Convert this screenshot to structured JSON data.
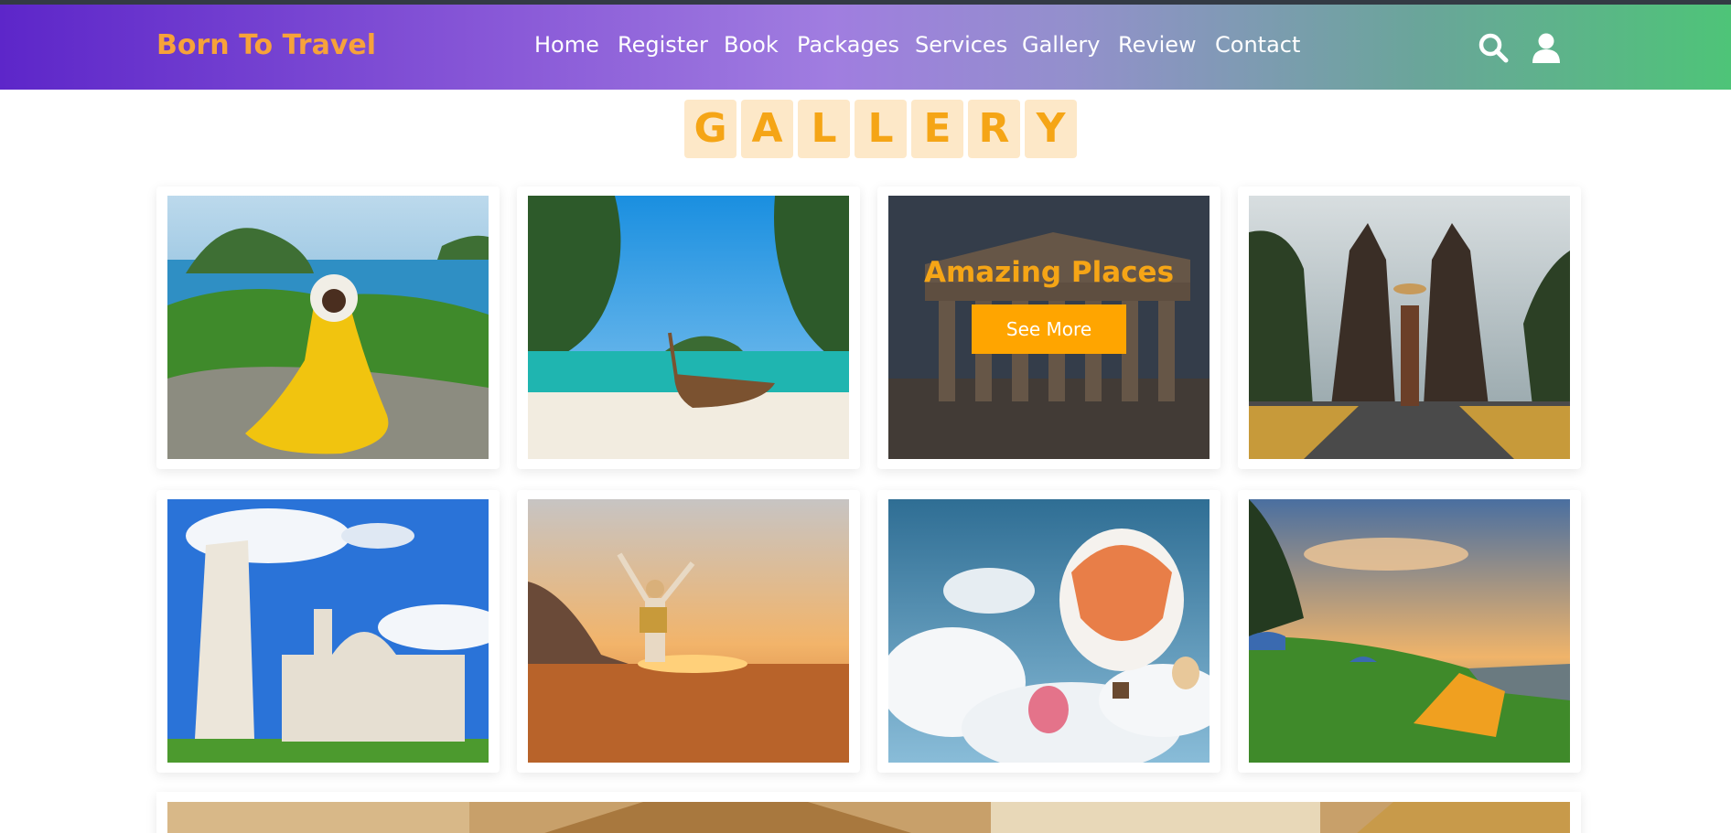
{
  "brand": {
    "name": "Born To Travel"
  },
  "nav": {
    "items": [
      {
        "label": "Home"
      },
      {
        "label": "Register"
      },
      {
        "label": "Book"
      },
      {
        "label": "Packages"
      },
      {
        "label": "Services"
      },
      {
        "label": "Gallery"
      },
      {
        "label": "Review"
      },
      {
        "label": "Contact"
      }
    ],
    "icons": [
      "search-icon",
      "user-icon"
    ]
  },
  "heading": {
    "letters": [
      "G",
      "A",
      "L",
      "L",
      "E",
      "R",
      "Y"
    ]
  },
  "gallery": {
    "hover_card": {
      "title": "Amazing Places",
      "button_label": "See More"
    },
    "photos": [
      "woman-yellow-dress-island-photo",
      "longtail-boat-beach-photo",
      "ancient-temple-photo",
      "temple-gate-traveler-photo",
      "leaning-tower-pisa-photo",
      "traveler-beach-sunset-photo",
      "hot-air-balloons-photo",
      "camping-tent-sunset-photo",
      "desert-pyramid-photo"
    ]
  },
  "colors": {
    "brand": "#f7a23a",
    "accent": "#ffa500",
    "heading_letter": "#f5a516",
    "heading_tile": "#fde8c8",
    "nav_gradient_start": "#5d26c9",
    "nav_gradient_end": "#4ec478"
  }
}
